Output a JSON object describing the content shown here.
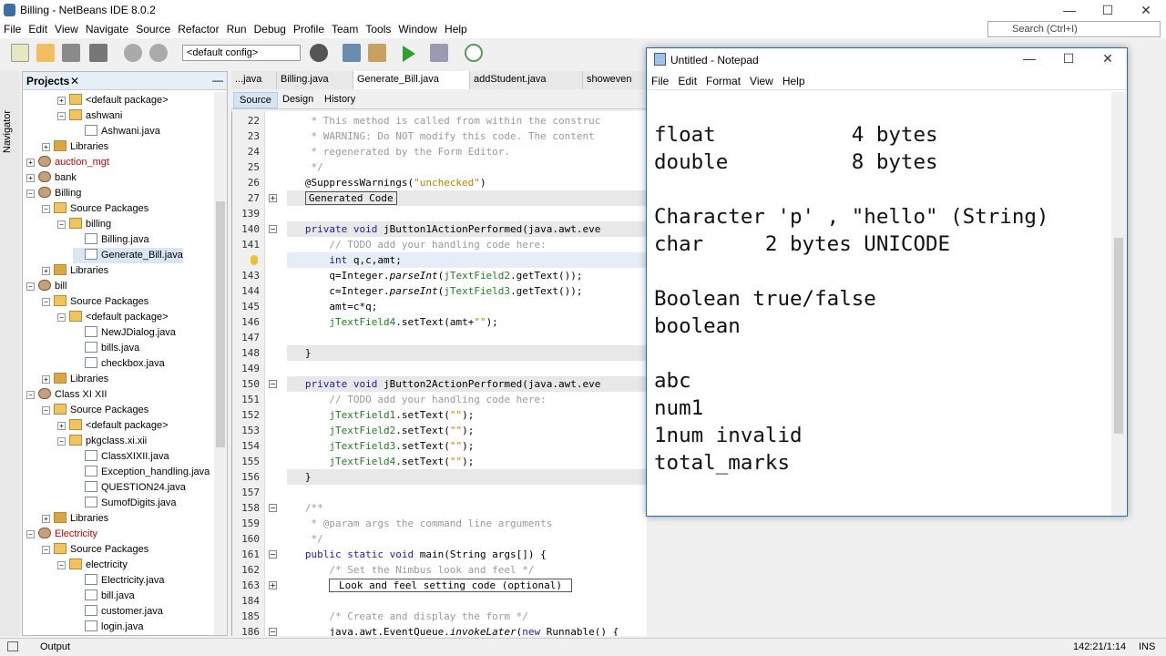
{
  "window": {
    "title": "Billing - NetBeans IDE 8.0.2",
    "min": "—",
    "max": "☐",
    "close": "✕"
  },
  "menu": [
    "File",
    "Edit",
    "View",
    "Navigate",
    "Source",
    "Refactor",
    "Run",
    "Debug",
    "Profile",
    "Team",
    "Tools",
    "Window",
    "Help"
  ],
  "toolbar": {
    "config": "<default config>",
    "search_placeholder": "Search (Ctrl+I)"
  },
  "navigator_label": "Navigator",
  "projects": {
    "title": "Projects",
    "close": "✕",
    "minimize": "—",
    "tree": [
      {
        "label": "<default package>",
        "level": 2,
        "type": "pkg",
        "exp": "+"
      },
      {
        "label": "ashwani",
        "level": 2,
        "type": "pkg",
        "exp": "−"
      },
      {
        "label": "Ashwani.java",
        "level": 3,
        "type": "java"
      },
      {
        "label": "Libraries",
        "level": 1,
        "type": "lib",
        "exp": "+"
      },
      {
        "label": "auction_mgt",
        "level": 0,
        "type": "proj",
        "exp": "+",
        "red": true
      },
      {
        "label": "bank",
        "level": 0,
        "type": "proj",
        "exp": "+"
      },
      {
        "label": "Billing",
        "level": 0,
        "type": "proj",
        "exp": "−"
      },
      {
        "label": "Source Packages",
        "level": 1,
        "type": "pkg",
        "exp": "−"
      },
      {
        "label": "billing",
        "level": 2,
        "type": "pkg",
        "exp": "−"
      },
      {
        "label": "Billing.java",
        "level": 3,
        "type": "java"
      },
      {
        "label": "Generate_Bill.java",
        "level": 3,
        "type": "java",
        "selected": true
      },
      {
        "label": "Libraries",
        "level": 1,
        "type": "lib",
        "exp": "+"
      },
      {
        "label": "bill",
        "level": 0,
        "type": "proj",
        "exp": "−"
      },
      {
        "label": "Source Packages",
        "level": 1,
        "type": "pkg",
        "exp": "−"
      },
      {
        "label": "<default package>",
        "level": 2,
        "type": "pkg",
        "exp": "−"
      },
      {
        "label": "NewJDialog.java",
        "level": 3,
        "type": "java"
      },
      {
        "label": "bills.java",
        "level": 3,
        "type": "java"
      },
      {
        "label": "checkbox.java",
        "level": 3,
        "type": "java"
      },
      {
        "label": "Libraries",
        "level": 1,
        "type": "lib",
        "exp": "+"
      },
      {
        "label": "Class XI XII",
        "level": 0,
        "type": "proj",
        "exp": "−"
      },
      {
        "label": "Source Packages",
        "level": 1,
        "type": "pkg",
        "exp": "−"
      },
      {
        "label": "<default package>",
        "level": 2,
        "type": "pkg",
        "exp": "+"
      },
      {
        "label": "pkgclass.xi.xii",
        "level": 2,
        "type": "pkg",
        "exp": "−"
      },
      {
        "label": "ClassXIXII.java",
        "level": 3,
        "type": "java"
      },
      {
        "label": "Exception_handling.java",
        "level": 3,
        "type": "java"
      },
      {
        "label": "QUESTION24.java",
        "level": 3,
        "type": "java"
      },
      {
        "label": "SumofDigits.java",
        "level": 3,
        "type": "java"
      },
      {
        "label": "Libraries",
        "level": 1,
        "type": "lib",
        "exp": "+"
      },
      {
        "label": "Electricity",
        "level": 0,
        "type": "proj",
        "exp": "−",
        "red": true
      },
      {
        "label": "Source Packages",
        "level": 1,
        "type": "pkg",
        "exp": "−"
      },
      {
        "label": "electricity",
        "level": 2,
        "type": "pkg",
        "exp": "−"
      },
      {
        "label": "Electricity.java",
        "level": 3,
        "type": "java"
      },
      {
        "label": "bill.java",
        "level": 3,
        "type": "java"
      },
      {
        "label": "customer.java",
        "level": 3,
        "type": "java"
      },
      {
        "label": "login.java",
        "level": 3,
        "type": "java"
      }
    ]
  },
  "editor": {
    "tabs": [
      "...java",
      "Billing.java",
      "Generate_Bill.java",
      "addStudent.java",
      "showeven"
    ],
    "active_tab": 2,
    "modes": [
      "Source",
      "Design",
      "History"
    ],
    "lines": [
      {
        "n": "22",
        "s": [
          [
            "    * This method is called from within the construc",
            "c"
          ]
        ]
      },
      {
        "n": "23",
        "s": [
          [
            "    * WARNING: Do NOT modify this code. The content",
            "c"
          ]
        ]
      },
      {
        "n": "24",
        "s": [
          [
            "    * regenerated by the Form Editor.",
            "c"
          ]
        ]
      },
      {
        "n": "25",
        "s": [
          [
            "    */",
            "c"
          ]
        ]
      },
      {
        "n": "26",
        "s": [
          [
            "   @SuppressWarnings(",
            ""
          ],
          [
            "\"unchecked\"",
            "s"
          ],
          [
            ")",
            ""
          ]
        ]
      },
      {
        "n": "27",
        "fold": "+",
        "hl": true,
        "s": [
          [
            "   ",
            ""
          ],
          [
            "Generated Code",
            "box"
          ]
        ]
      },
      {
        "n": "139",
        "s": []
      },
      {
        "n": "140",
        "fold": "−",
        "hl": true,
        "s": [
          [
            "   ",
            ""
          ],
          [
            "private void",
            "k"
          ],
          [
            " jButton1ActionPerformed(java.awt.eve",
            ""
          ]
        ]
      },
      {
        "n": "141",
        "s": [
          [
            "       // TODO add your handling code here:",
            "c"
          ]
        ]
      },
      {
        "n": "",
        "cur": true,
        "s": [
          [
            "       ",
            ""
          ],
          [
            "int",
            "k"
          ],
          [
            " q,c,amt;",
            ""
          ]
        ]
      },
      {
        "n": "143",
        "s": [
          [
            "       q=Integer.",
            ""
          ],
          [
            "parseInt",
            "i"
          ],
          [
            "(",
            ""
          ],
          [
            "jTextField2",
            "f"
          ],
          [
            ".getText());",
            ""
          ]
        ]
      },
      {
        "n": "144",
        "s": [
          [
            "       c=Integer.",
            ""
          ],
          [
            "parseInt",
            "i"
          ],
          [
            "(",
            ""
          ],
          [
            "jTextField3",
            "f"
          ],
          [
            ".getText());",
            ""
          ]
        ]
      },
      {
        "n": "145",
        "s": [
          [
            "       amt=c*q;",
            ""
          ]
        ]
      },
      {
        "n": "146",
        "s": [
          [
            "       ",
            ""
          ],
          [
            "jTextField4",
            "f"
          ],
          [
            ".setText(amt+",
            ""
          ],
          [
            "\"\"",
            "s"
          ],
          [
            ");",
            ""
          ]
        ]
      },
      {
        "n": "147",
        "s": []
      },
      {
        "n": "148",
        "hl": true,
        "s": [
          [
            "   }",
            ""
          ]
        ]
      },
      {
        "n": "149",
        "s": []
      },
      {
        "n": "150",
        "fold": "−",
        "hl": true,
        "s": [
          [
            "   ",
            ""
          ],
          [
            "private void",
            "k"
          ],
          [
            " jButton2ActionPerformed(java.awt.eve",
            ""
          ]
        ]
      },
      {
        "n": "151",
        "s": [
          [
            "       // TODO add your handling code here:",
            "c"
          ]
        ]
      },
      {
        "n": "152",
        "s": [
          [
            "       ",
            ""
          ],
          [
            "jTextField1",
            "f"
          ],
          [
            ".setText(",
            ""
          ],
          [
            "\"\"",
            "s"
          ],
          [
            ");",
            ""
          ]
        ]
      },
      {
        "n": "153",
        "s": [
          [
            "       ",
            ""
          ],
          [
            "jTextField2",
            "f"
          ],
          [
            ".setText(",
            ""
          ],
          [
            "\"\"",
            "s"
          ],
          [
            ");",
            ""
          ]
        ]
      },
      {
        "n": "154",
        "s": [
          [
            "       ",
            ""
          ],
          [
            "jTextField3",
            "f"
          ],
          [
            ".setText(",
            ""
          ],
          [
            "\"\"",
            "s"
          ],
          [
            ");",
            ""
          ]
        ]
      },
      {
        "n": "155",
        "s": [
          [
            "       ",
            ""
          ],
          [
            "jTextField4",
            "f"
          ],
          [
            ".setText(",
            ""
          ],
          [
            "\"\"",
            "s"
          ],
          [
            ");",
            ""
          ]
        ]
      },
      {
        "n": "156",
        "hl": true,
        "s": [
          [
            "   }",
            ""
          ]
        ]
      },
      {
        "n": "157",
        "s": []
      },
      {
        "n": "158",
        "fold": "−",
        "s": [
          [
            "   /**",
            "c"
          ]
        ]
      },
      {
        "n": "159",
        "s": [
          [
            "    * @param args the command line arguments",
            "c"
          ]
        ]
      },
      {
        "n": "160",
        "s": [
          [
            "    */",
            "c"
          ]
        ]
      },
      {
        "n": "161",
        "fold": "−",
        "s": [
          [
            "   ",
            ""
          ],
          [
            "public static void",
            "k"
          ],
          [
            " main(String args[]) {",
            ""
          ]
        ]
      },
      {
        "n": "162",
        "s": [
          [
            "       /* Set the Nimbus look and feel */",
            "c"
          ]
        ]
      },
      {
        "n": "163",
        "fold": "+",
        "s": [
          [
            "       ",
            ""
          ],
          [
            " Look and feel setting code (optional) ",
            "box"
          ]
        ]
      },
      {
        "n": "184",
        "s": []
      },
      {
        "n": "185",
        "s": [
          [
            "       /* Create and display the form */",
            "c"
          ]
        ]
      },
      {
        "n": "186",
        "fold": "−",
        "s": [
          [
            "       java.awt.EventQueue.",
            ""
          ],
          [
            "invokeLater",
            "i"
          ],
          [
            "(",
            ""
          ],
          [
            "new",
            "k"
          ],
          [
            " Runnable() {",
            ""
          ]
        ]
      }
    ]
  },
  "notepad": {
    "title": "Untitled - Notepad",
    "menu": [
      "File",
      "Edit",
      "Format",
      "View",
      "Help"
    ],
    "text": "\nfloat           4 bytes\ndouble          8 bytes\n\nCharacter 'p' , \"hello\" (String)\nchar     2 bytes UNICODE\n\nBoolean true/false\nboolean\n\nabc\nnum1\n1num invalid\ntotal_marks\n"
  },
  "status": {
    "output": "Output",
    "position": "142:21/1:14",
    "mode": "INS"
  }
}
